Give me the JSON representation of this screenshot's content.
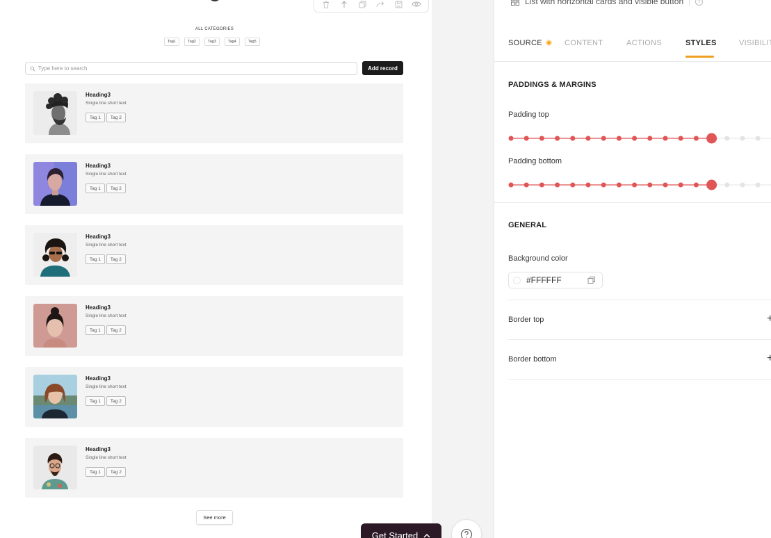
{
  "colors": {
    "accent": "#F0A020",
    "slider_active": "#E05555",
    "slider_inactive": "#E4E4E4",
    "dark_button": "#1C1C1C",
    "get_started_bg": "#2B1A26"
  },
  "preview": {
    "toolbar_icons": [
      "trash-icon",
      "arrow-up-icon",
      "duplicate-icon",
      "redo-icon",
      "save-icon",
      "eye-icon"
    ],
    "categories_title": "ALL CATEGORIES",
    "category_tags": [
      "Tag1",
      "Tag2",
      "Tag3",
      "Tag4",
      "Tag5"
    ],
    "search_placeholder": "Type here to search",
    "add_record_label": "Add record",
    "cards": [
      {
        "heading": "Heading3",
        "subtext": "Single line short text",
        "tags": [
          "Tag 1",
          "Tag 2"
        ],
        "photo": "man-curly-beard"
      },
      {
        "heading": "Heading3",
        "subtext": "Single line short text",
        "tags": [
          "Tag 1",
          "Tag 2"
        ],
        "photo": "woman-purple-bg"
      },
      {
        "heading": "Heading3",
        "subtext": "Single line short text",
        "tags": [
          "Tag 1",
          "Tag 2"
        ],
        "photo": "man-sunglasses"
      },
      {
        "heading": "Heading3",
        "subtext": "Single line short text",
        "tags": [
          "Tag 1",
          "Tag 2"
        ],
        "photo": "woman-pink-bg"
      },
      {
        "heading": "Heading3",
        "subtext": "Single line short text",
        "tags": [
          "Tag 1",
          "Tag 2"
        ],
        "photo": "woman-bob-hair"
      },
      {
        "heading": "Heading3",
        "subtext": "Single line short text",
        "tags": [
          "Tag 1",
          "Tag 2"
        ],
        "photo": "man-glasses-floral"
      }
    ],
    "see_more_label": "See more",
    "get_started_label": "Get Started"
  },
  "panel": {
    "block_name": "List with horizontal cards and visible button",
    "help_glyph": "?",
    "tabs": [
      "SOURCE",
      "CONTENT",
      "ACTIONS",
      "STYLES",
      "VISIBILIT"
    ],
    "active_tab": "STYLES",
    "paddings_title": "PADDINGS & MARGINS",
    "padding_top_label": "Padding top",
    "padding_top_level": 13,
    "padding_bottom_label": "Padding bottom",
    "padding_bottom_level": 13,
    "slider_steps": 18,
    "general_title": "GENERAL",
    "bg_color_label": "Background color",
    "bg_color_value": "#FFFFFF",
    "border_top_label": "Border top",
    "border_bottom_label": "Border bottom",
    "plus_glyph": "+"
  }
}
